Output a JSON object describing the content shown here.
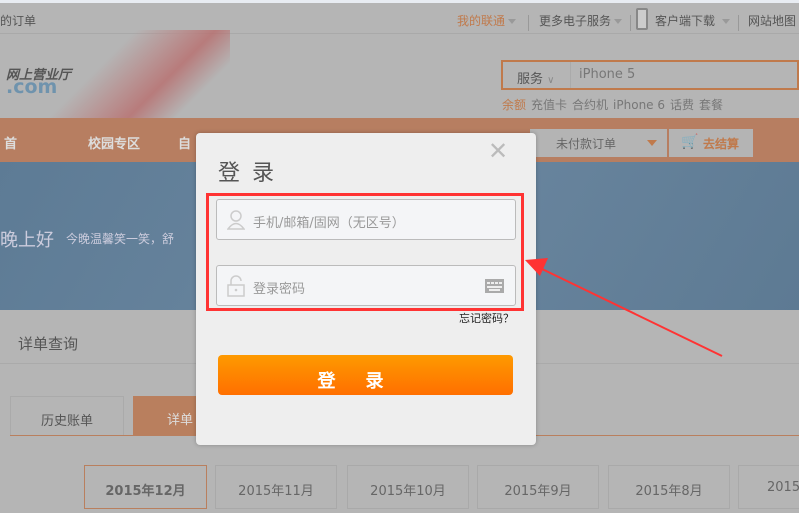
{
  "topbar": {
    "my_orders": "的订单",
    "my_unicom": "我的联通",
    "more_services": "更多电子服务",
    "client_download": "客户端下载",
    "site_map": "网站地图"
  },
  "logo": {
    "line1": "网上营业厅",
    "line2": ".com"
  },
  "search": {
    "category": "服务",
    "placeholder": "iPhone 5",
    "hot": [
      "余额",
      "充值卡",
      "合约机",
      "iPhone 6",
      "话费",
      "套餐"
    ]
  },
  "nav": {
    "items": [
      "首",
      "校园专区",
      "自"
    ],
    "unpaid_orders": "未付款订单",
    "checkout": "去结算"
  },
  "banner": {
    "greeting": "晚上好",
    "message": "今晚温馨笑一笑，舒"
  },
  "section": {
    "title": "详单查询",
    "tabs": [
      "历史账单",
      "详单"
    ]
  },
  "months": [
    "2015年12月",
    "2015年11月",
    "2015年10月",
    "2015年9月",
    "2015年8月",
    "2015"
  ],
  "modal": {
    "title": "登录",
    "username_placeholder": "手机/邮箱/固网（无区号）",
    "password_placeholder": "登录密码",
    "forgot": "忘记密码？",
    "login_button": "登录"
  },
  "colors": {
    "accent": "#ff7f00",
    "highlight": "#ff3333",
    "nav": "#b77e61"
  }
}
